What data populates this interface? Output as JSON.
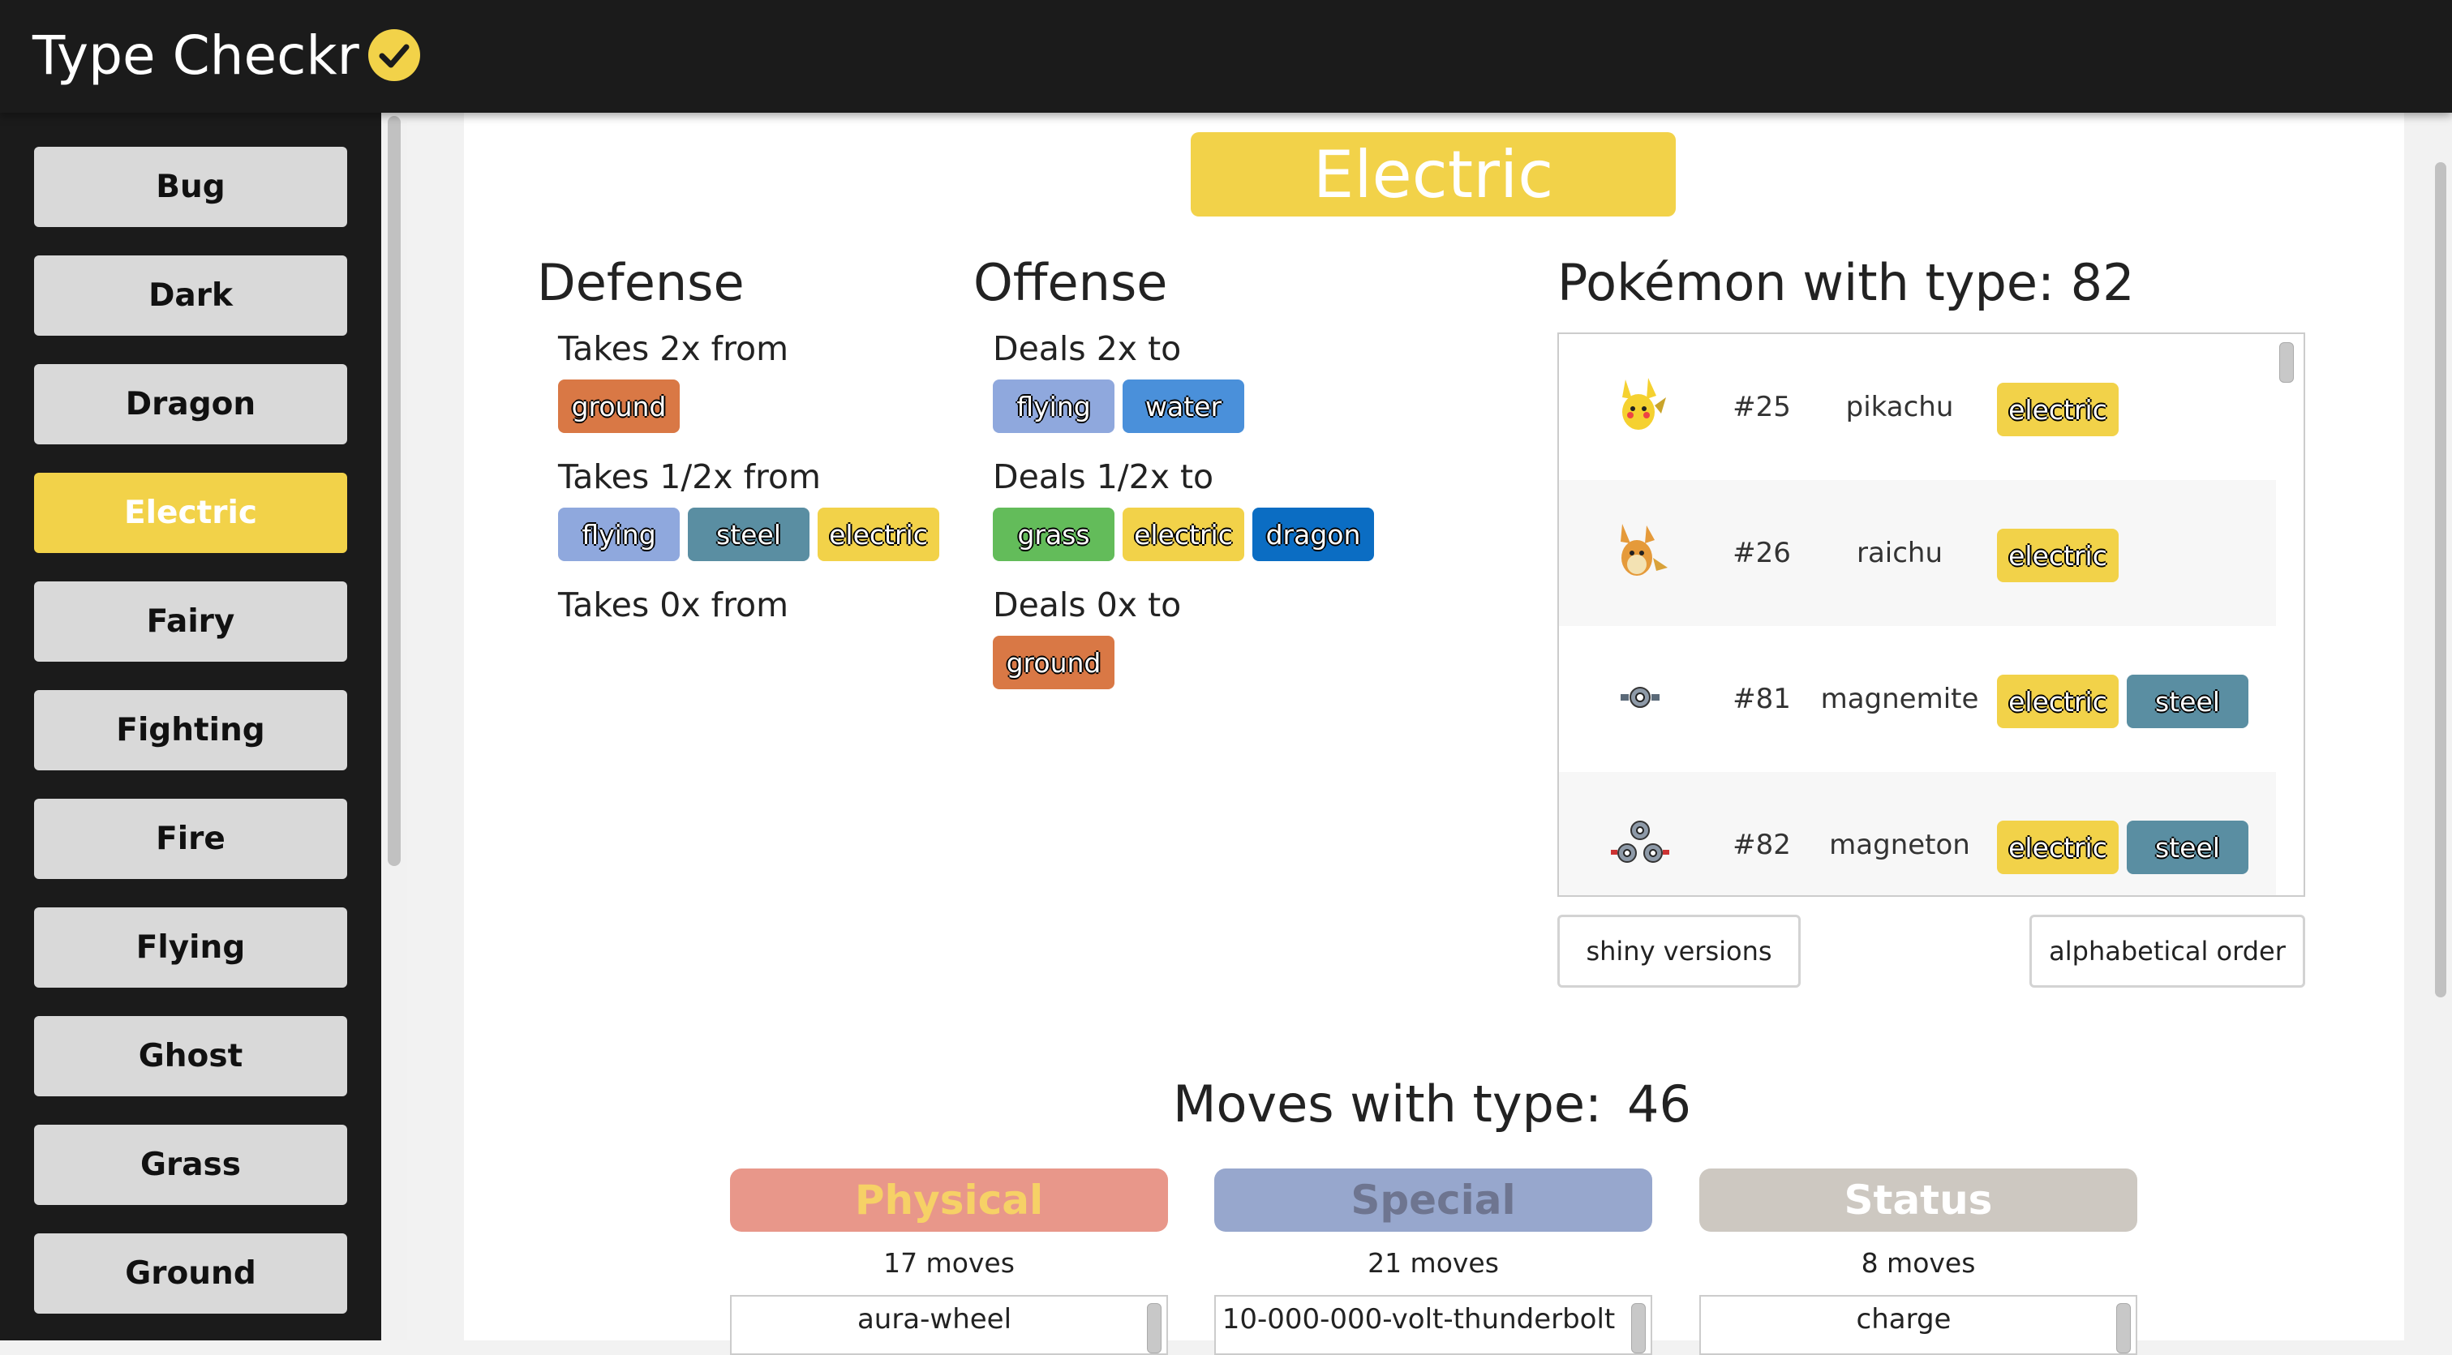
{
  "app": {
    "title": "Type Checkr",
    "check_icon": "check-circle-icon",
    "accent": "#f2d249"
  },
  "sidebar": {
    "items": [
      {
        "label": "Bug",
        "active": false
      },
      {
        "label": "Dark",
        "active": false
      },
      {
        "label": "Dragon",
        "active": false
      },
      {
        "label": "Electric",
        "active": true
      },
      {
        "label": "Fairy",
        "active": false
      },
      {
        "label": "Fighting",
        "active": false
      },
      {
        "label": "Fire",
        "active": false
      },
      {
        "label": "Flying",
        "active": false
      },
      {
        "label": "Ghost",
        "active": false
      },
      {
        "label": "Grass",
        "active": false
      },
      {
        "label": "Ground",
        "active": false
      }
    ]
  },
  "type_colors": {
    "ground": "#d97845",
    "flying": "#8fa8dd",
    "steel": "#5a8ea2",
    "electric": "#f2d249",
    "grass": "#63bc5a",
    "water": "#4a90da",
    "dragon": "#0b6dc3"
  },
  "main": {
    "title": "Electric",
    "defense": {
      "heading": "Defense",
      "groups": [
        {
          "label": "Takes 2x from",
          "types": [
            "ground"
          ]
        },
        {
          "label": "Takes 1/2x from",
          "types": [
            "flying",
            "steel",
            "electric"
          ]
        },
        {
          "label": "Takes 0x from",
          "types": []
        }
      ]
    },
    "offense": {
      "heading": "Offense",
      "groups": [
        {
          "label": "Deals 2x to",
          "types": [
            "flying",
            "water"
          ]
        },
        {
          "label": "Deals 1/2x to",
          "types": [
            "grass",
            "electric",
            "dragon"
          ]
        },
        {
          "label": "Deals 0x to",
          "types": [
            "ground"
          ]
        }
      ]
    },
    "pokemon": {
      "heading": "Pokémon with type: 82",
      "rows": [
        {
          "num": "#25",
          "name": "pikachu",
          "types": [
            "electric"
          ],
          "sprite": "pikachu-sprite"
        },
        {
          "num": "#26",
          "name": "raichu",
          "types": [
            "electric"
          ],
          "sprite": "raichu-sprite"
        },
        {
          "num": "#81",
          "name": "magnemite",
          "types": [
            "electric",
            "steel"
          ],
          "sprite": "magnemite-sprite"
        },
        {
          "num": "#82",
          "name": "magneton",
          "types": [
            "electric",
            "steel"
          ],
          "sprite": "magneton-sprite"
        }
      ],
      "shiny_button": "shiny versions",
      "order_button": "alphabetical order"
    },
    "moves": {
      "heading": "Moves with type:",
      "count": "46",
      "categories": [
        {
          "label": "Physical",
          "count_text": "17 moves",
          "first_move": "aura-wheel",
          "bg": "#e8978a",
          "fg": "#f6d166"
        },
        {
          "label": "Special",
          "count_text": "21 moves",
          "first_move": "10-000-000-volt-thunderbolt",
          "bg": "#97a7cd",
          "fg": "#6e7590"
        },
        {
          "label": "Status",
          "count_text": "8 moves",
          "first_move": "charge",
          "bg": "#cdc8c1",
          "fg": "#ffffff"
        }
      ]
    }
  }
}
